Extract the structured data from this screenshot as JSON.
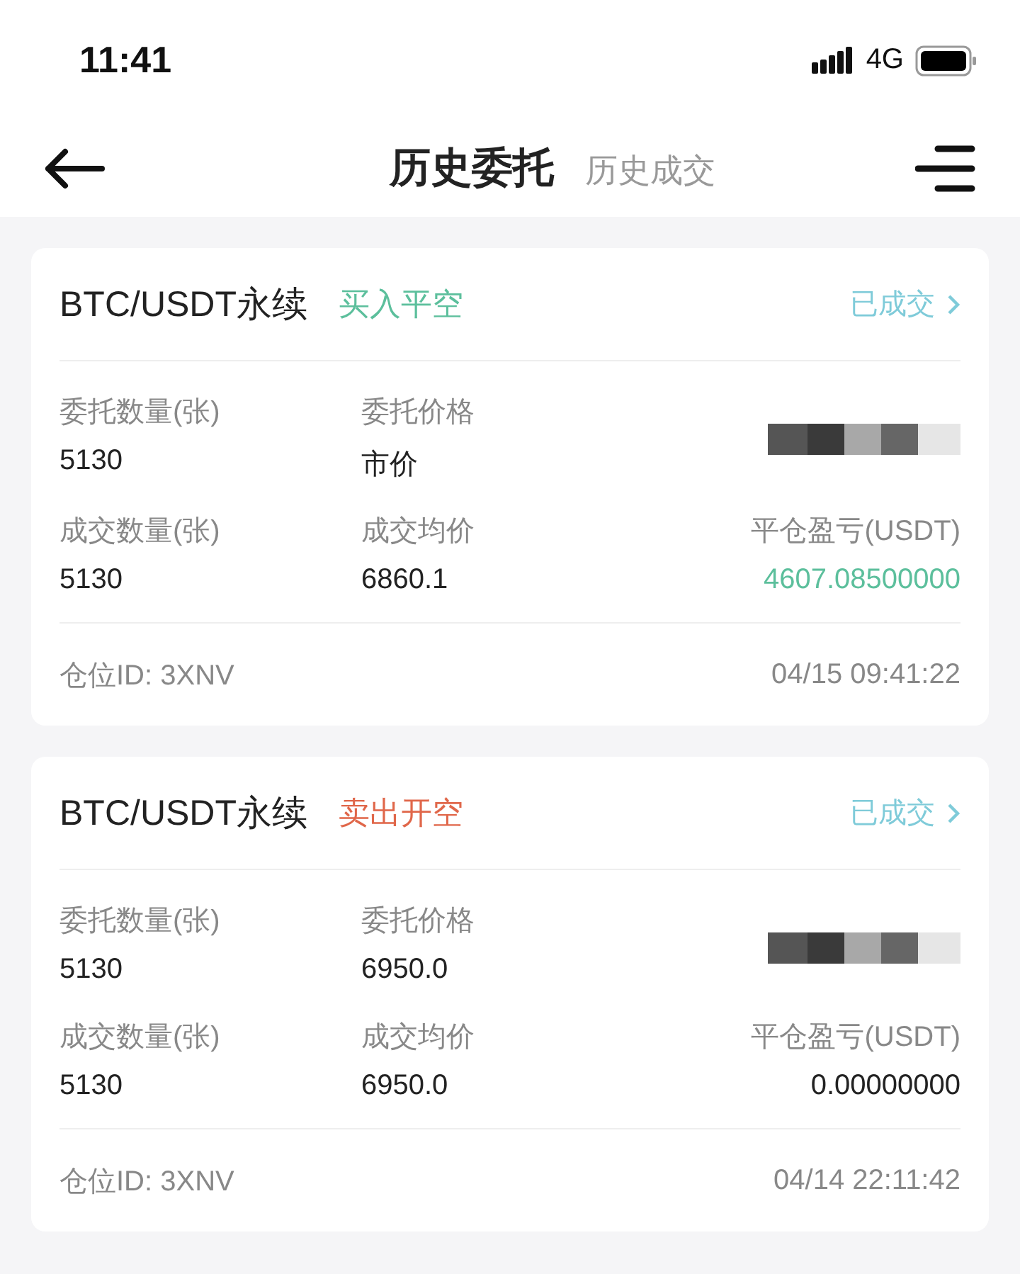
{
  "status_bar": {
    "time": "11:41",
    "network": "4G"
  },
  "nav": {
    "tabs": [
      {
        "label": "历史委托",
        "selected": true
      },
      {
        "label": "历史成交",
        "selected": false
      }
    ]
  },
  "orders": [
    {
      "pair": "BTC/USDT永续",
      "side": {
        "label": "买入平空",
        "kind": "buy"
      },
      "status": "已成交",
      "rows": [
        [
          {
            "kind": "text",
            "label": "委托数量(张)",
            "value": "5130"
          },
          {
            "kind": "text",
            "label": "委托价格",
            "value": "市价"
          },
          {
            "kind": "redacted"
          }
        ],
        [
          {
            "kind": "text",
            "label": "成交数量(张)",
            "value": "5130"
          },
          {
            "kind": "text",
            "label": "成交均价",
            "value": "6860.1"
          },
          {
            "kind": "text",
            "label": "平仓盈亏(USDT)",
            "value": "4607.08500000",
            "color": "#5cbf9c"
          }
        ]
      ],
      "position": "仓位ID: 3XNV",
      "time": "04/15 09:41:22"
    },
    {
      "pair": "BTC/USDT永续",
      "side": {
        "label": "卖出开空",
        "kind": "sell"
      },
      "status": "已成交",
      "rows": [
        [
          {
            "kind": "text",
            "label": "委托数量(张)",
            "value": "5130"
          },
          {
            "kind": "text",
            "label": "委托价格",
            "value": "6950.0"
          },
          {
            "kind": "redacted"
          }
        ],
        [
          {
            "kind": "text",
            "label": "成交数量(张)",
            "value": "5130"
          },
          {
            "kind": "text",
            "label": "成交均价",
            "value": "6950.0"
          },
          {
            "kind": "text",
            "label": "平仓盈亏(USDT)",
            "value": "0.00000000",
            "color": "#222222"
          }
        ]
      ],
      "position": "仓位ID: 3XNV",
      "time": "04/14 22:11:42"
    }
  ]
}
